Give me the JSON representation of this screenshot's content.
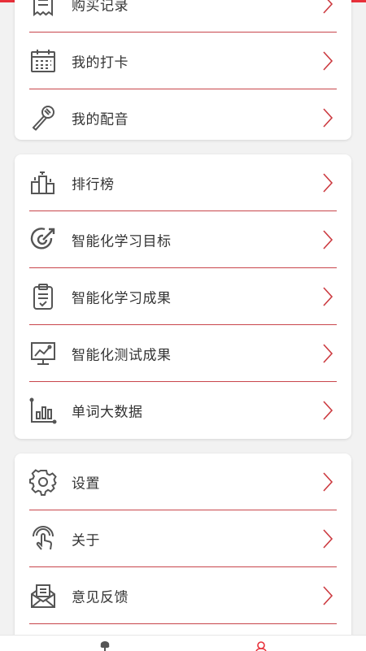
{
  "colors": {
    "accent": "#e8303a",
    "divider": "#c8454b",
    "chevron": "#cc3a40",
    "icon": "#555555",
    "text": "#333333",
    "background": "#f2f2f2"
  },
  "card1": {
    "items": [
      {
        "label": "购买记录",
        "icon": "receipt-icon"
      },
      {
        "label": "我的打卡",
        "icon": "calendar-icon"
      },
      {
        "label": "我的配音",
        "icon": "microphone-icon"
      }
    ]
  },
  "card2": {
    "items": [
      {
        "label": "排行榜",
        "icon": "ranking-icon"
      },
      {
        "label": "智能化学习目标",
        "icon": "target-icon"
      },
      {
        "label": "智能化学习成果",
        "icon": "clipboard-icon"
      },
      {
        "label": "智能化测试成果",
        "icon": "chart-monitor-icon"
      },
      {
        "label": "单词大数据",
        "icon": "bar-chart-icon"
      }
    ]
  },
  "card3": {
    "items": [
      {
        "label": "设置",
        "icon": "gear-icon"
      },
      {
        "label": "关于",
        "icon": "touch-icon"
      },
      {
        "label": "意见反馈",
        "icon": "mail-icon"
      }
    ]
  },
  "bottom_nav": {
    "items": [
      {
        "icon": "tree-icon"
      },
      {
        "icon": "user-icon"
      }
    ]
  }
}
